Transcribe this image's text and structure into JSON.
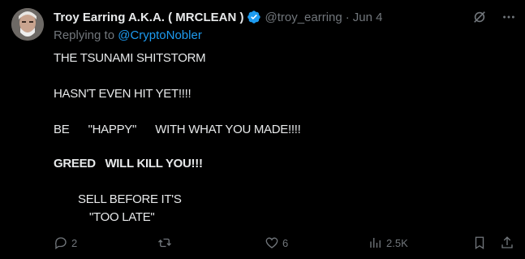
{
  "tweet": {
    "author_name": "Troy Earring A.K.A. ( MRCLEAN )",
    "handle": "@troy_earring",
    "separator": "·",
    "date": "Jun 4",
    "replying_prefix": "Replying to",
    "replying_to": "@CryptoNobler",
    "lines": [
      "THE TSUNAMI SHITSTORM",
      "HASN'T EVEN HIT YET!!!!",
      "BE      \"HAPPY\"      WITH WHAT YOU MADE!!!!",
      "GREED   WILL KILL YOU!!!",
      "SELL BEFORE IT'S",
      "\"TOO LATE\""
    ]
  },
  "actions": {
    "replies": "2",
    "retweets": "",
    "likes": "6",
    "views": "2.5K"
  },
  "icons": {
    "verified": "verified-badge-icon",
    "grok": "grok-icon",
    "more": "more-icon",
    "reply": "reply-icon",
    "retweet": "retweet-icon",
    "like": "heart-icon",
    "views": "views-icon",
    "bookmark": "bookmark-icon",
    "share": "share-icon"
  },
  "colors": {
    "background": "#000000",
    "text": "#e7e9ea",
    "muted": "#71767b",
    "accent": "#1d9bf0"
  }
}
